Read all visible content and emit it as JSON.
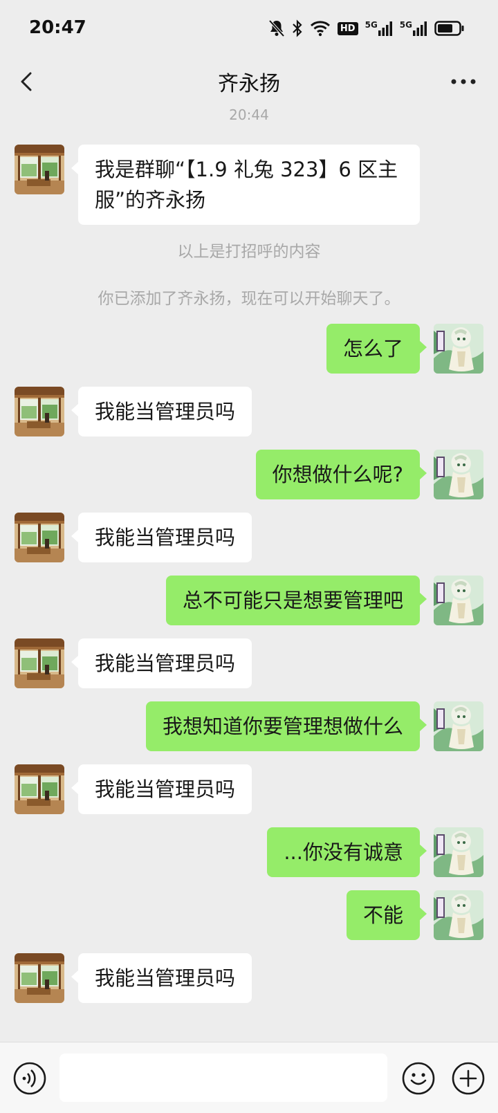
{
  "status_bar": {
    "time": "20:47",
    "icons": [
      "mute-bell-icon",
      "bluetooth-icon",
      "wifi-icon",
      "hd-icon",
      "signal-5g-icon",
      "signal-5g-icon",
      "battery-icon"
    ],
    "hd_label": "HD",
    "net_label": "5G"
  },
  "header": {
    "title": "齐永扬",
    "back_icon": "chevron-left-icon",
    "more_icon": "more-dots-icon"
  },
  "chat": {
    "timestamp": "20:44",
    "greeting": "我是群聊“【1.9 礼兔 323】6 区主服”的齐永扬",
    "tip_greeting_above": "以上是打招呼的内容",
    "tip_added": "你已添加了齐永扬，现在可以开始聊天了。",
    "messages": [
      {
        "from": "me",
        "text": "怎么了"
      },
      {
        "from": "them",
        "text": "我能当管理员吗"
      },
      {
        "from": "me",
        "text": "你想做什么呢?"
      },
      {
        "from": "them",
        "text": "我能当管理员吗"
      },
      {
        "from": "me",
        "text": "总不可能只是想要管理吧"
      },
      {
        "from": "them",
        "text": "我能当管理员吗"
      },
      {
        "from": "me",
        "text": "我想知道你要管理想做什么"
      },
      {
        "from": "them",
        "text": "我能当管理员吗"
      },
      {
        "from": "me",
        "text": "...你没有诚意"
      },
      {
        "from": "me",
        "text": "不能"
      },
      {
        "from": "them",
        "text": "我能当管理员吗"
      }
    ]
  },
  "input_bar": {
    "voice_icon": "voice-icon",
    "emoji_icon": "emoji-icon",
    "plus_icon": "plus-icon",
    "input_value": ""
  },
  "colors": {
    "background": "#ededed",
    "outgoing_bubble": "#95ec69",
    "incoming_bubble": "#ffffff",
    "system_text": "#a8a8a8"
  }
}
